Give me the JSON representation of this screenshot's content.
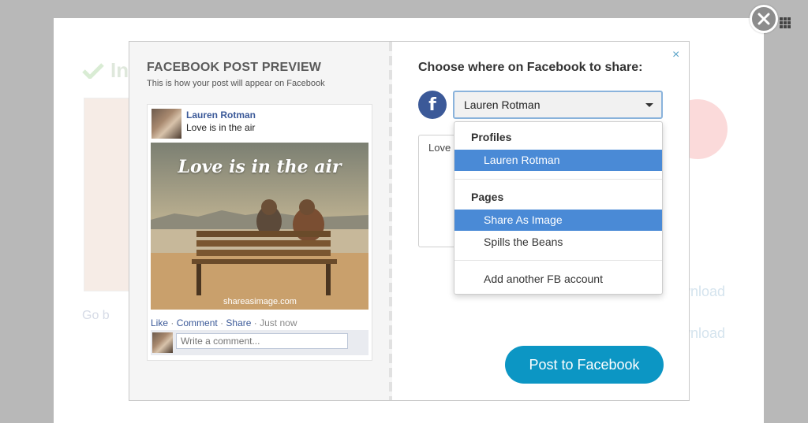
{
  "background": {
    "title_partial": "In",
    "goback_partial": "Go b",
    "download_1_partial": "wnload",
    "download_2_partial": "wnload"
  },
  "modal": {
    "left": {
      "title": "FACEBOOK POST PREVIEW",
      "subtitle": "This is how your post will appear on Facebook",
      "post": {
        "author": "Lauren Rotman",
        "caption": "Love is in the air",
        "image_text": "Love is in the air",
        "watermark": "shareasimage.com",
        "actions": {
          "like": "Like",
          "comment": "Comment",
          "share": "Share",
          "time": "Just now"
        },
        "comment_placeholder": "Write a comment..."
      }
    },
    "right": {
      "title": "Choose where on Facebook to share:",
      "facebook_letter": "f",
      "selected_account": "Lauren Rotman",
      "message_partial": "Love",
      "dropdown": {
        "profiles_header": "Profiles",
        "profiles": [
          "Lauren Rotman"
        ],
        "pages_header": "Pages",
        "pages": [
          "Share As Image",
          "Spills the Beans"
        ],
        "add_account": "Add another FB account"
      },
      "post_button": "Post to Facebook",
      "close_glyph": "×"
    }
  },
  "colors": {
    "facebook_blue": "#3b5998",
    "highlight": "#4a8ad6",
    "post_button": "#0c96c4"
  },
  "icons": [
    "close-circle-icon",
    "grid-icon",
    "check-icon",
    "facebook-icon",
    "pinterest-icon",
    "chevron-down-icon"
  ]
}
